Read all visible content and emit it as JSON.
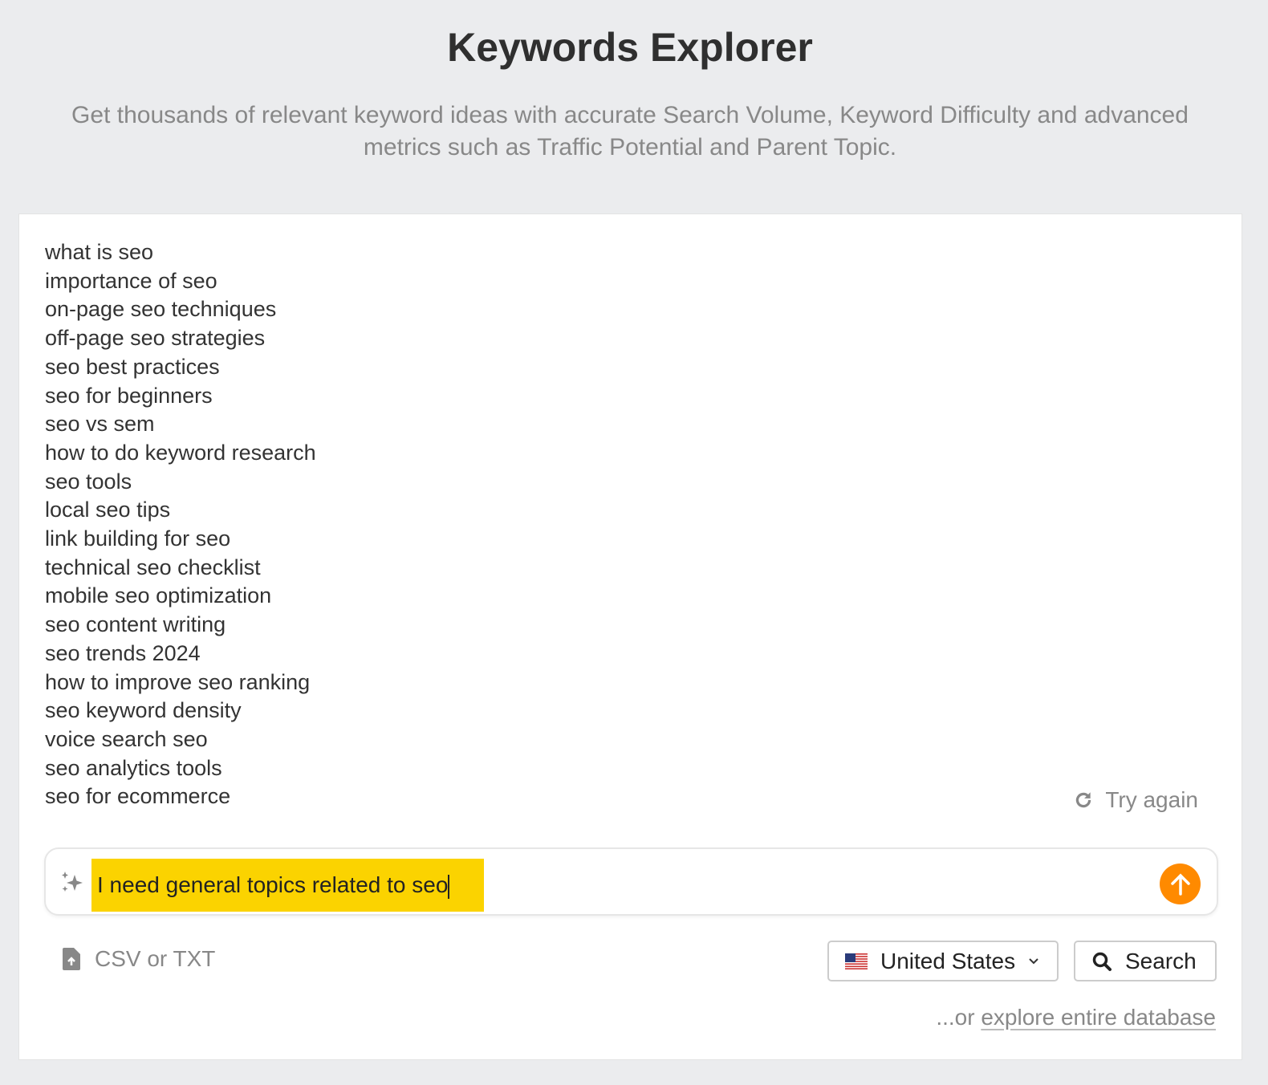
{
  "header": {
    "title": "Keywords Explorer",
    "subtitle": "Get thousands of relevant keyword ideas with accurate Search Volume, Keyword Difficulty and advanced metrics such as Traffic Potential and Parent Topic."
  },
  "keywords": [
    "what is seo",
    "importance of seo",
    "on-page seo techniques",
    "off-page seo strategies",
    "seo best practices",
    "seo for beginners",
    "seo vs sem",
    "how to do keyword research",
    "seo tools",
    "local seo tips",
    "link building for seo",
    "technical seo checklist",
    "mobile seo optimization",
    "seo content writing",
    "seo trends 2024",
    "how to improve seo ranking",
    "seo keyword density",
    "voice search seo",
    "seo analytics tools",
    "seo for ecommerce"
  ],
  "try_again": "Try again",
  "prompt": {
    "value": "I need general topics related to seo"
  },
  "upload": {
    "label": "CSV or TXT"
  },
  "country": {
    "selected": "United States"
  },
  "search": {
    "label": "Search"
  },
  "explore": {
    "prefix": "...or ",
    "link": "explore entire database"
  },
  "colors": {
    "accent": "#ff8a00",
    "highlight": "#fbd300"
  }
}
